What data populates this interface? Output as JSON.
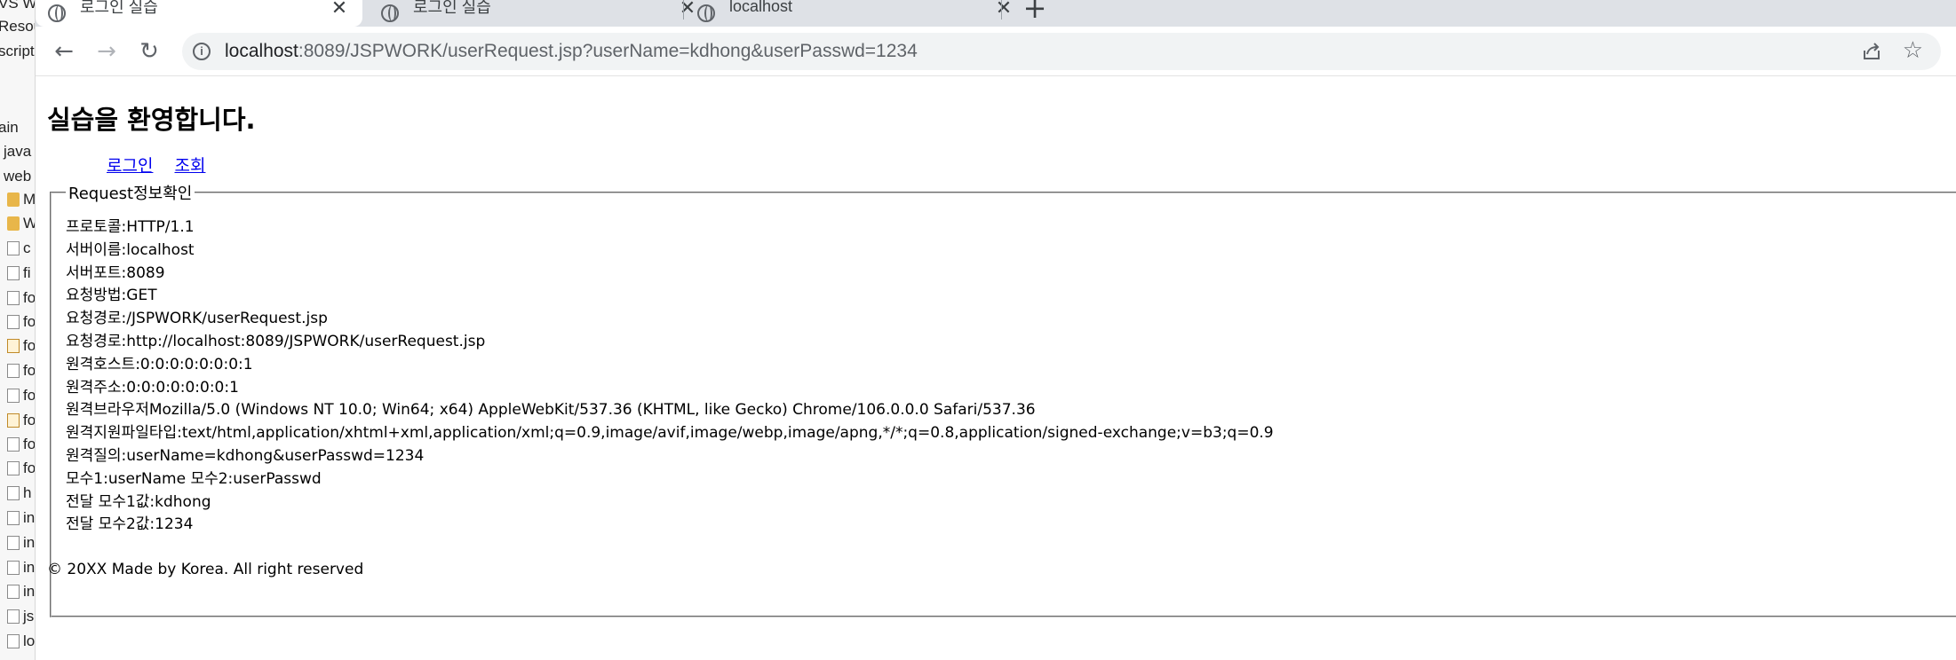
{
  "ide": {
    "items": [
      {
        "label": "VS W",
        "glyph": "none"
      },
      {
        "label": "Resou",
        "glyph": "none"
      },
      {
        "label": "script",
        "glyph": "none"
      },
      {
        "label": "ain",
        "glyph": "none"
      },
      {
        "label": "java",
        "glyph": "none"
      },
      {
        "label": "web",
        "glyph": "none"
      },
      {
        "label": "M",
        "glyph": "folder"
      },
      {
        "label": "W",
        "glyph": "folder"
      },
      {
        "label": "c",
        "glyph": "file"
      },
      {
        "label": "fi",
        "glyph": "file"
      },
      {
        "label": "fo",
        "glyph": "file"
      },
      {
        "label": "fo",
        "glyph": "file"
      },
      {
        "label": "fo",
        "glyph": "jsp"
      },
      {
        "label": "fo",
        "glyph": "file"
      },
      {
        "label": "fo",
        "glyph": "file"
      },
      {
        "label": "fo",
        "glyph": "jsp"
      },
      {
        "label": "fo",
        "glyph": "file"
      },
      {
        "label": "fo",
        "glyph": "file"
      },
      {
        "label": "h",
        "glyph": "file"
      },
      {
        "label": "in",
        "glyph": "file"
      },
      {
        "label": "in",
        "glyph": "file"
      },
      {
        "label": "in",
        "glyph": "file"
      },
      {
        "label": "in",
        "glyph": "file"
      },
      {
        "label": "js",
        "glyph": "file"
      },
      {
        "label": "lo",
        "glyph": "file"
      }
    ]
  },
  "browser": {
    "tabs": [
      {
        "title": "로그인 실습",
        "active": true,
        "icon": "globe-icon"
      },
      {
        "title": "로그인 실습",
        "active": false,
        "icon": "globe-icon"
      },
      {
        "title": "localhost",
        "active": false,
        "icon": "globe-icon"
      }
    ],
    "new_tab": "+",
    "nav": {
      "back": "←",
      "forward": "→",
      "reload": "↻"
    },
    "url_host": "localhost",
    "url_rest": ":8089/JSPWORK/userRequest.jsp?userName=kdhong&userPasswd=1234",
    "star": "☆"
  },
  "page": {
    "heading": "실습을 환영합니다.",
    "links": [
      "로그인",
      "조회"
    ],
    "fieldset_legend": "Request정보확인",
    "lines": [
      "프로토콜:HTTP/1.1",
      "서버이름:localhost",
      "서버포트:8089",
      "요청방법:GET",
      "요청경로:/JSPWORK/userRequest.jsp",
      "요청경로:http://localhost:8089/JSPWORK/userRequest.jsp",
      "원격호스트:0:0:0:0:0:0:0:1",
      "원격주소:0:0:0:0:0:0:0:1",
      "원격브라우저Mozilla/5.0 (Windows NT 10.0; Win64; x64) AppleWebKit/537.36 (KHTML, like Gecko) Chrome/106.0.0.0 Safari/537.36",
      "원격지원파일타입:text/html,application/xhtml+xml,application/xml;q=0.9,image/avif,image/webp,image/apng,*/*;q=0.8,application/signed-exchange;v=b3;q=0.9",
      "원격질의:userName=kdhong&userPasswd=1234",
      "모수1:userName 모수2:userPasswd",
      "전달 모수1값:kdhong",
      "전달 모수2값:1234"
    ],
    "footer": "© 20XX Made by Korea. All right reserved"
  }
}
